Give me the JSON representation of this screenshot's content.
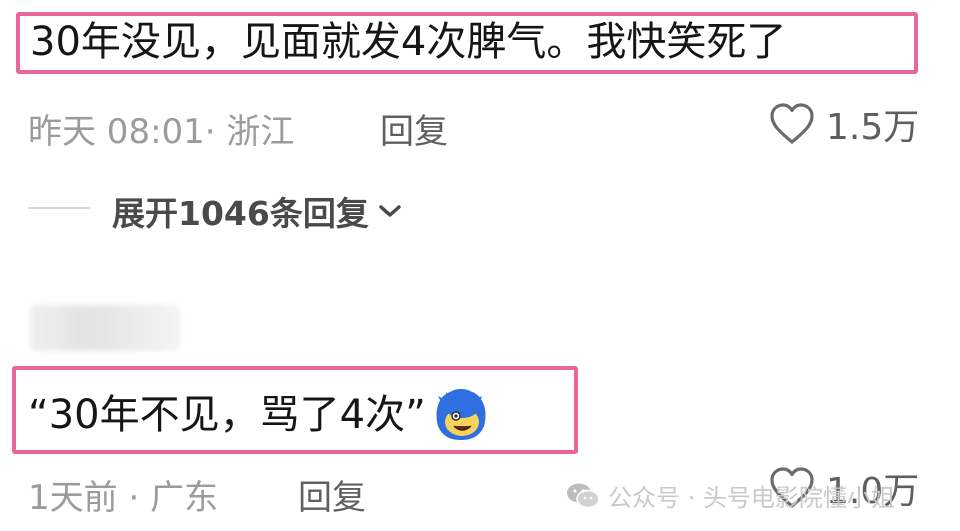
{
  "comment1": {
    "text": "30年没见，见面就发4次脾气。我快笑死了",
    "time": "昨天 08:01",
    "separator": "·",
    "location": "浙江",
    "reply_label": "回复",
    "like_count": "1.5万",
    "expand_label": "展开1046条回复"
  },
  "comment2": {
    "text": "“30年不见，骂了4次”",
    "time": "1天前",
    "separator": "·",
    "location": "广东",
    "reply_label": "回复",
    "like_count": "1.0万"
  },
  "watermark": {
    "text": "公众号 · 头号电影院懂小姐"
  },
  "colors": {
    "highlight_border": "#e8669a",
    "meta_text": "#9b9b9b"
  }
}
